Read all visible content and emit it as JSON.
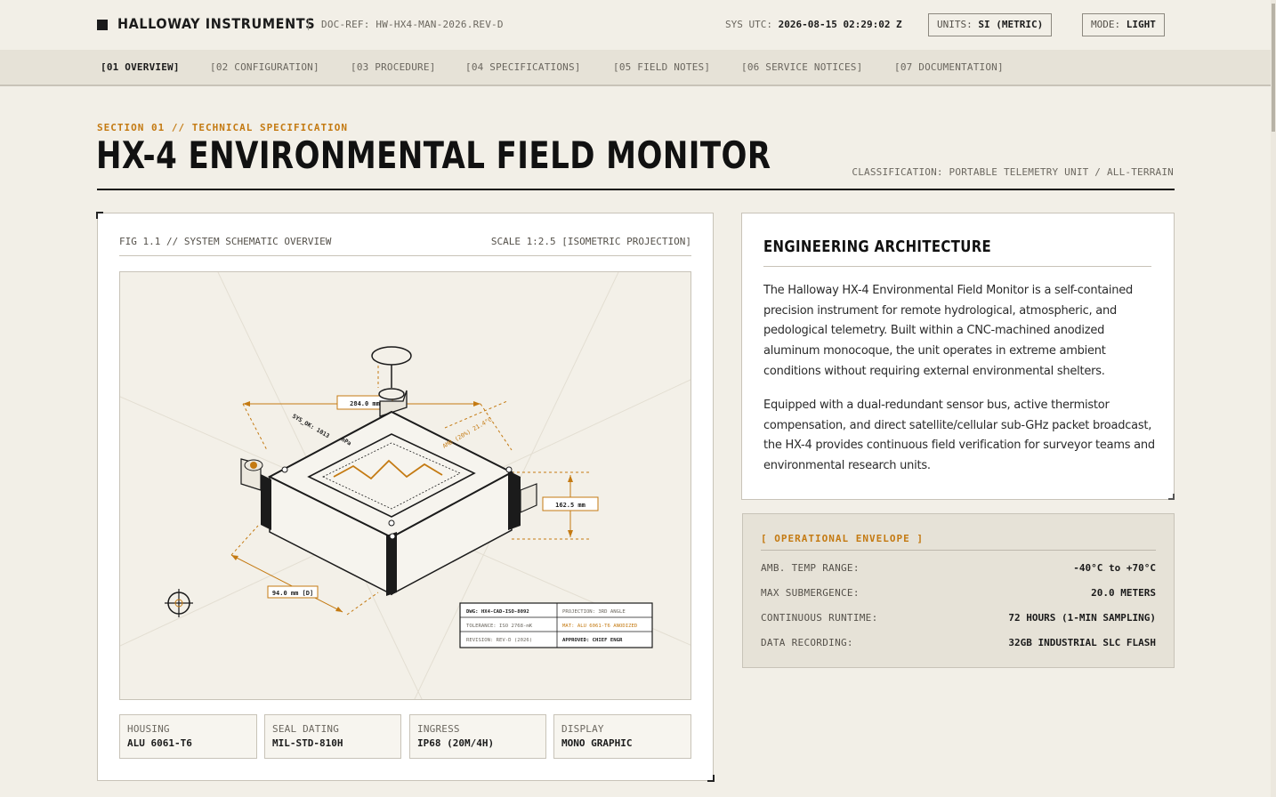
{
  "header": {
    "brand": "HALLOWAY INSTRUMENTS",
    "separator": "|",
    "doc_ref": "DOC-REF: HW-HX4-MAN-2026.REV-D",
    "sys_utc_label": "SYS UTC:",
    "sys_utc_value": "2026-08-15 02:29:02 Z",
    "units_label": "UNITS:",
    "units_value": "SI (METRIC)",
    "mode_label": "MODE:",
    "mode_value": "LIGHT"
  },
  "nav": {
    "items": [
      {
        "label": "[01 OVERVIEW]",
        "active": true
      },
      {
        "label": "[02 CONFIGURATION]",
        "active": false
      },
      {
        "label": "[03 PROCEDURE]",
        "active": false
      },
      {
        "label": "[04 SPECIFICATIONS]",
        "active": false
      },
      {
        "label": "[05 FIELD NOTES]",
        "active": false
      },
      {
        "label": "[06 SERVICE NOTICES]",
        "active": false
      },
      {
        "label": "[07 DOCUMENTATION]",
        "active": false
      }
    ]
  },
  "section": {
    "tag": "SECTION 01 // TECHNICAL SPECIFICATION",
    "title": "HX-4 ENVIRONMENTAL FIELD MONITOR",
    "classification": "CLASSIFICATION: PORTABLE TELEMETRY UNIT / ALL-TERRAIN"
  },
  "figure": {
    "caption": "FIG 1.1 // SYSTEM SCHEMATIC OVERVIEW",
    "scale": "SCALE 1:2.5 [ISOMETRIC PROJECTION]",
    "dim_width": "284.0 mm",
    "dim_height": "162.5 mm",
    "dim_depth": "94.0 mm [D]",
    "label_sys_ok": "SYS_OK: 1013",
    "label_hpa": "hPa",
    "label_amb": "AMB (20%) 21.4°C",
    "title_block": {
      "dwg": "DWG: HX4-CAD-ISO-8092",
      "projection": "PROJECTION: 3RD ANGLE",
      "tolerance": "TOLERANCE: ISO 2768-mK",
      "material": "MAT: ALU 6061-T6 ANODIZED",
      "revision": "REVISION: REV-D (2026)",
      "approved": "APPROVED: CHIEF ENGR"
    }
  },
  "specs": [
    {
      "label": "HOUSING",
      "value": "ALU 6061-T6"
    },
    {
      "label": "SEAL DATING",
      "value": "MIL-STD-810H"
    },
    {
      "label": "INGRESS",
      "value": "IP68 (20M/4H)"
    },
    {
      "label": "DISPLAY",
      "value": "MONO GRAPHIC"
    }
  ],
  "architecture": {
    "title": "ENGINEERING ARCHITECTURE",
    "paragraph1": "The Halloway HX-4 Environmental Field Monitor is a self-contained precision instrument for remote hydrological, atmospheric, and pedological telemetry. Built within a CNC-machined anodized aluminum monocoque, the unit operates in extreme ambient conditions without requiring external environmental shelters.",
    "paragraph2": "Equipped with a dual-redundant sensor bus, active thermistor compensation, and direct satellite/cellular sub-GHz packet broadcast, the HX-4 provides continuous field verification for surveyor teams and environmental research units."
  },
  "envelope": {
    "title": "[ OPERATIONAL ENVELOPE ]",
    "rows": [
      {
        "key": "AMB. TEMP RANGE:",
        "value": "-40°C to +70°C"
      },
      {
        "key": "MAX SUBMERGENCE:",
        "value": "20.0 METERS"
      },
      {
        "key": "CONTINUOUS RUNTIME:",
        "value": "72 HOURS (1-MIN SAMPLING)"
      },
      {
        "key": "DATA RECORDING:",
        "value": "32GB INDUSTRIAL SLC FLASH"
      }
    ]
  },
  "colors": {
    "background": "#f2efe7",
    "accent": "#c47a12",
    "ink": "#1b1b1b",
    "panel": "#e6e2d7"
  }
}
